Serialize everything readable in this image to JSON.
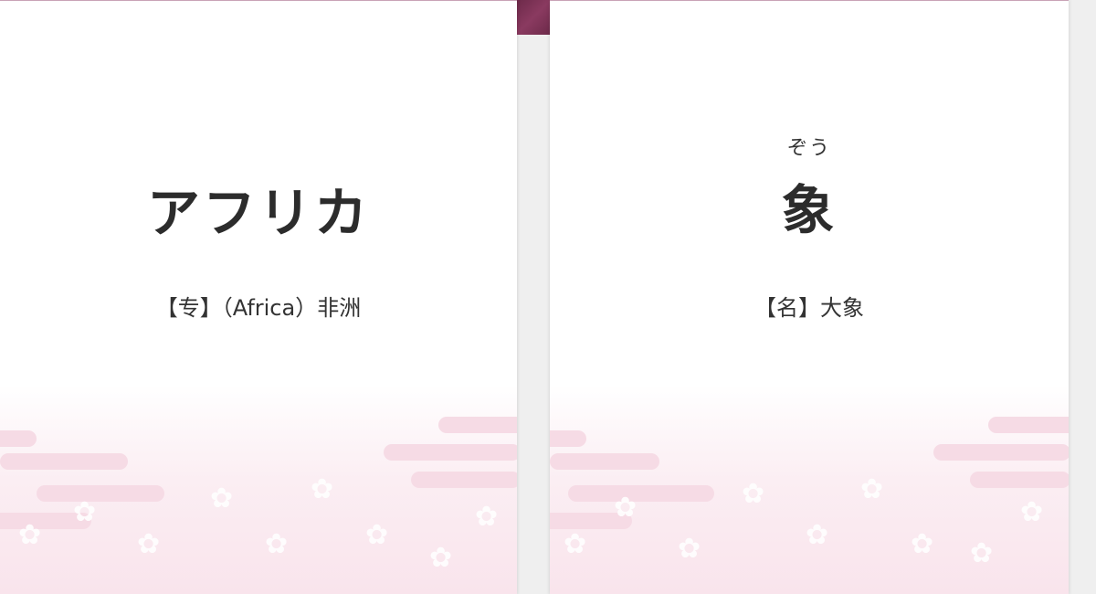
{
  "colors": {
    "accent": "#7a3154",
    "card_bg": "#ffffff",
    "page_bg": "#efefef",
    "pattern_pink": "#f6dbe5",
    "text": "#2c2c2c"
  },
  "cards": [
    {
      "reading": "",
      "headword": "アフリカ",
      "definition": "【专】（Africa）非洲"
    },
    {
      "reading": "ぞう",
      "headword": "象",
      "definition": "【名】大象"
    }
  ],
  "decoration": {
    "pattern_icon": "sakura-cloud-pattern",
    "flower_glyph": "✿"
  }
}
